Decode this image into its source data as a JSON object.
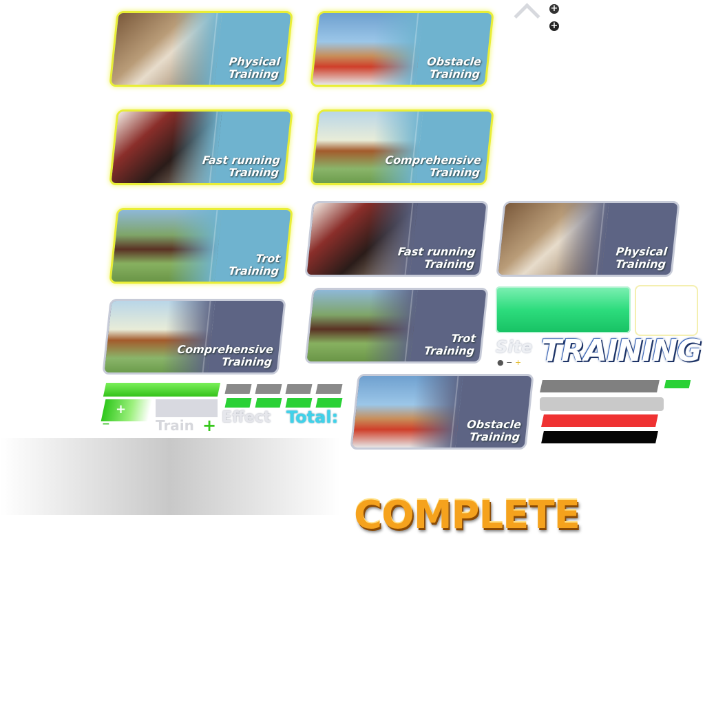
{
  "cards": {
    "c1": {
      "line1": "Physical",
      "line2": "Training"
    },
    "c2": {
      "line1": "Obstacle",
      "line2": "Training"
    },
    "c3": {
      "line1": "Fast running",
      "line2": "Training"
    },
    "c4": {
      "line1": "Comprehensive",
      "line2": "Training"
    },
    "c5": {
      "line1": "Trot",
      "line2": "Training"
    },
    "c6": {
      "line1": "Fast running",
      "line2": "Training"
    },
    "c7": {
      "line1": "Physical",
      "line2": "Training"
    },
    "c8": {
      "line1": "Comprehensive",
      "line2": "Training"
    },
    "c9": {
      "line1": "Trot",
      "line2": "Training"
    },
    "c10": {
      "line1": "Obstacle",
      "line2": "Training"
    }
  },
  "labels": {
    "site": "Site",
    "training": "TRAINING",
    "train": "Train",
    "effect": "Effect",
    "total": "Total:",
    "complete": "COMPLETE"
  },
  "icons": {
    "plus": "+",
    "minus": "−"
  },
  "colors": {
    "active_card": "#6fb3cf",
    "idle_card": "#5d6484",
    "highlight_border": "#e9ee36",
    "green": "#2ddc7d",
    "complete_orange": "#f5a21d"
  }
}
